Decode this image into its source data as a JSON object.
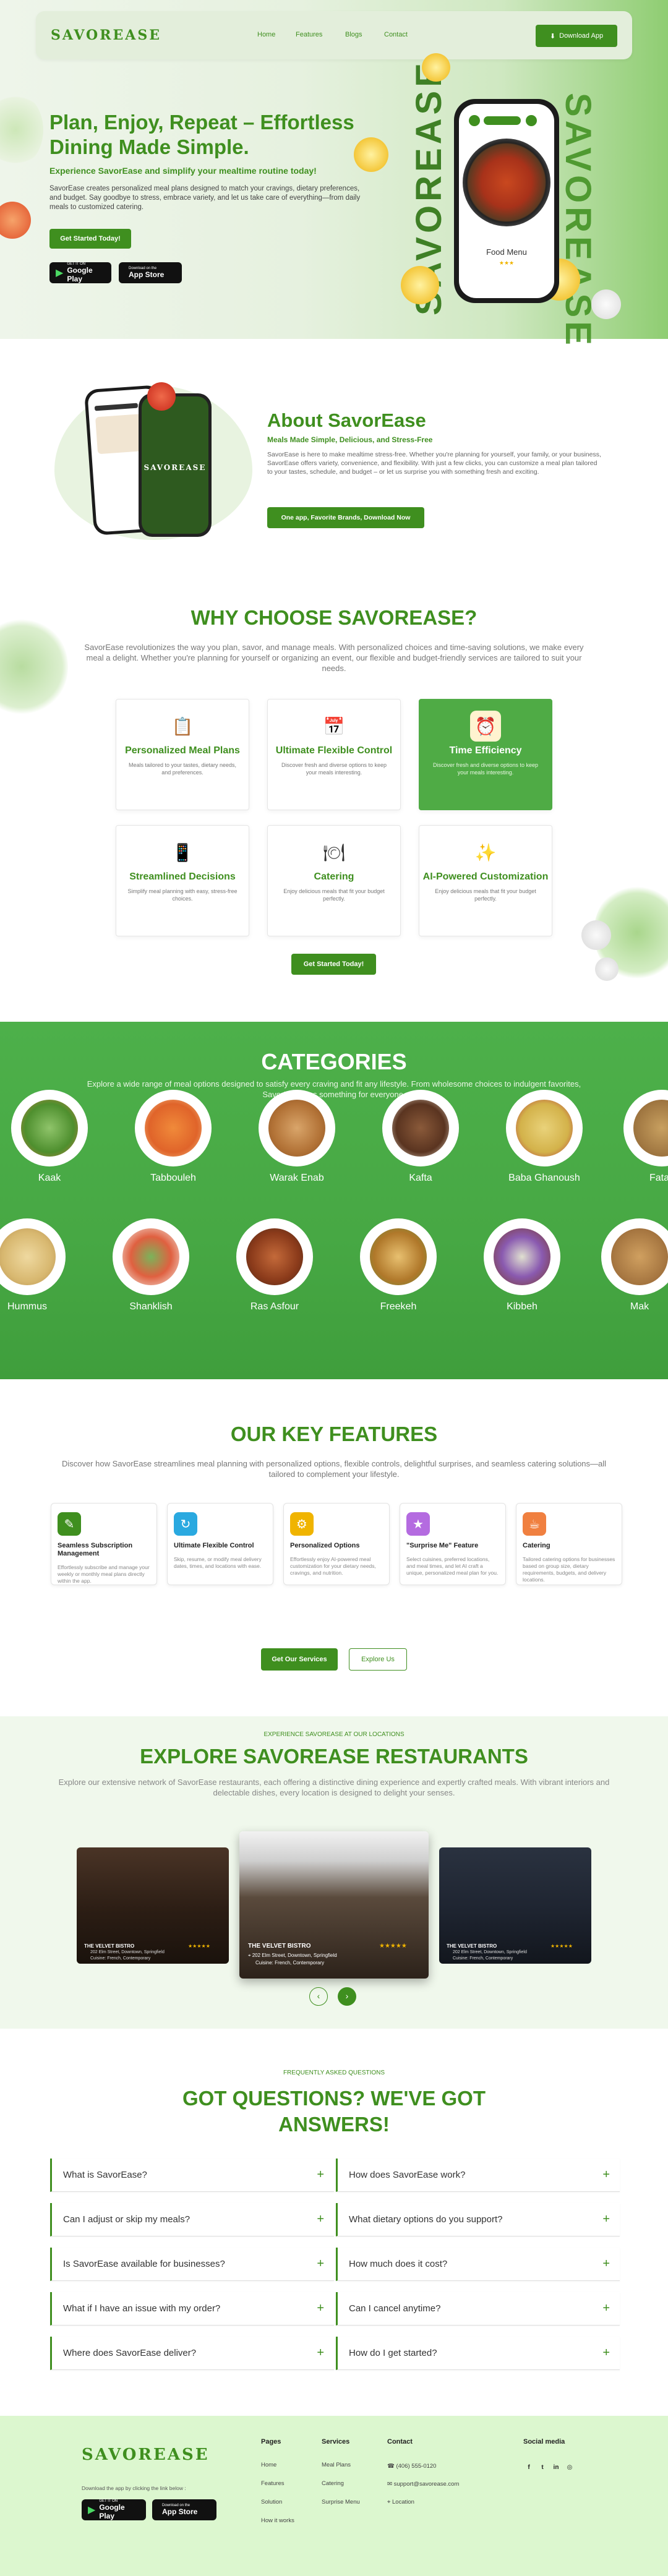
{
  "brand": "SAVOREASE",
  "nav": {
    "links": [
      "Home",
      "Features",
      "Blogs",
      "Contact"
    ],
    "download": "Download App"
  },
  "hero": {
    "title": "Plan, Enjoy, Repeat – Effortless Dining Made Simple.",
    "subtitle": "Experience SavorEase and simplify your mealtime routine today!",
    "body": "SavorEase creates personalized meal plans designed to match your cravings, dietary preferences, and budget. Say goodbye to stress, embrace variety, and let us take care of everything—from daily meals to customized catering.",
    "cta": "Get Started Today!",
    "google_small": "GET IT ON",
    "google": "Google Play",
    "apple_small": "Download on the",
    "apple": "App Store",
    "vertical_text": "SAVOREASE",
    "phone_caption": "Food Menu"
  },
  "about": {
    "title": "About SavorEase",
    "subtitle": "Meals Made Simple, Delicious, and Stress-Free",
    "body": "SavorEase is here to make mealtime stress-free. Whether you're planning for yourself, your family, or your business, SavorEase offers variety, convenience, and flexibility. With just a few clicks, you can customize a meal plan tailored to your tastes, schedule, and budget – or let us surprise you with something fresh and exciting.",
    "cta": "One app, Favorite Brands, Download Now",
    "phone_logo": "SAVOREASE"
  },
  "why": {
    "title": "WHY CHOOSE SAVOREASE?",
    "body": "SavorEase revolutionizes the way you plan, savor, and manage meals. With personalized choices and time-saving solutions, we make every meal a delight. Whether you're planning for yourself or organizing an event, our flexible and budget-friendly services are tailored to suit your needs.",
    "cards": [
      {
        "title": "Personalized Meal Plans",
        "text": "Meals tailored to your tastes, dietary needs, and preferences.",
        "icon": "clipboard-icon"
      },
      {
        "title": "Ultimate Flexible Control",
        "text": "Discover fresh and diverse options to keep your meals interesting.",
        "icon": "calendar-icon"
      },
      {
        "title": "Time Efficiency",
        "text": "Discover fresh and diverse options to keep your meals interesting.",
        "icon": "clock-icon"
      },
      {
        "title": "Streamlined Decisions",
        "text": "Simplify meal planning with easy, stress-free choices.",
        "icon": "phone-icon"
      },
      {
        "title": "Catering",
        "text": "Enjoy delicious meals that fit your budget perfectly.",
        "icon": "tray-icon"
      },
      {
        "title": "AI-Powered Customization",
        "text": "Enjoy delicious meals that fit your budget perfectly.",
        "icon": "sparkle-icon"
      }
    ],
    "cta": "Get Started Today!"
  },
  "categories": {
    "title": "CATEGORIES",
    "body": "Explore a wide range of meal options designed to satisfy every craving and fit any lifestyle. From wholesome choices to indulgent favorites, SavorEase has something for everyone.",
    "row1": [
      "Kaak",
      "Tabbouleh",
      "Warak Enab",
      "Kafta",
      "Baba Ghanoush",
      "Fatay"
    ],
    "row2": [
      "Hummus",
      "Shanklish",
      "Ras Asfour",
      "Freekeh",
      "Kibbeh",
      "Mak"
    ]
  },
  "features": {
    "title": "OUR KEY FEATURES",
    "body": "Discover how SavorEase streamlines meal planning with personalized options, flexible controls, delightful surprises, and seamless catering solutions—all tailored to complement your lifestyle.",
    "items": [
      {
        "title": "Seamless Subscription Management",
        "text": "Effortlessly subscribe and manage your weekly or monthly meal plans directly within the app.",
        "color": "#3f8f1f",
        "icon": "subscription-icon"
      },
      {
        "title": "Ultimate Flexible Control",
        "text": "Skip, resume, or modify meal delivery dates, times, and locations with ease.",
        "color": "#2aa9e0",
        "icon": "control-icon"
      },
      {
        "title": "Personalized Options",
        "text": "Effortlessly enjoy AI-powered meal customization for your dietary needs, cravings, and nutrition.",
        "color": "#f0b400",
        "icon": "options-icon"
      },
      {
        "title": "\"Surprise Me\" Feature",
        "text": "Select cuisines, preferred locations, and meal times, and let AI craft a unique, personalized meal plan for you.",
        "color": "#b46be0",
        "icon": "surprise-icon"
      },
      {
        "title": "Catering",
        "text": "Tailored catering options for businesses based on group size, dietary requirements, budgets, and delivery locations.",
        "color": "#f08040",
        "icon": "catering-icon"
      }
    ],
    "cta1": "Get Our Services",
    "cta2": "Explore Us"
  },
  "restaurants": {
    "eyebrow": "EXPERIENCE SAVOREASE AT OUR LOCATIONS",
    "title": "EXPLORE SAVOREASE RESTAURANTS",
    "body": "Explore our extensive network of SavorEase restaurants, each offering a distinctive dining experience and expertly crafted meals. With vibrant interiors and delectable dishes, every location is designed to delight your senses.",
    "cards": [
      {
        "name": "THE VELVET BISTRO",
        "stars": "★★★★★",
        "address": "202 Elm Street, Downtown, Springfield",
        "cuisine": "Cuisine: French, Contemporary"
      },
      {
        "name": "THE VELVET BISTRO",
        "stars": "★★★★★",
        "address": "202 Elm Street, Downtown, Springfield",
        "cuisine": "Cuisine: French, Contemporary"
      },
      {
        "name": "THE VELVET BISTRO",
        "stars": "★★★★★",
        "address": "202 Elm Street, Downtown, Springfield",
        "cuisine": "Cuisine: French, Contemporary"
      }
    ]
  },
  "faq": {
    "eyebrow": "FREQUENTLY ASKED QUESTIONS",
    "title": "GOT QUESTIONS? WE'VE GOT ANSWERS!",
    "left": [
      "What is SavorEase?",
      "Can I adjust or skip my meals?",
      "Is SavorEase available for businesses?",
      "What if I have an issue with my order?",
      "Where does SavorEase deliver?"
    ],
    "right": [
      "How does SavorEase work?",
      "What dietary options do you support?",
      "How much does it cost?",
      "Can I cancel anytime?",
      "How do I get started?"
    ]
  },
  "footer": {
    "logo": "SAVOREASE",
    "download_text": "Download the app by clicking the link below :",
    "pages_title": "Pages",
    "pages": [
      "Home",
      "Features",
      "Solution",
      "How it works"
    ],
    "services_title": "Services",
    "services": [
      "Meal Plans",
      "Catering",
      "Surprise Menu"
    ],
    "contact_title": "Contact",
    "contact": [
      "(406) 555-0120",
      "support@savorease.com",
      "Location"
    ],
    "social_title": "Social media",
    "social": [
      "f",
      "t",
      "in",
      "◎"
    ]
  }
}
